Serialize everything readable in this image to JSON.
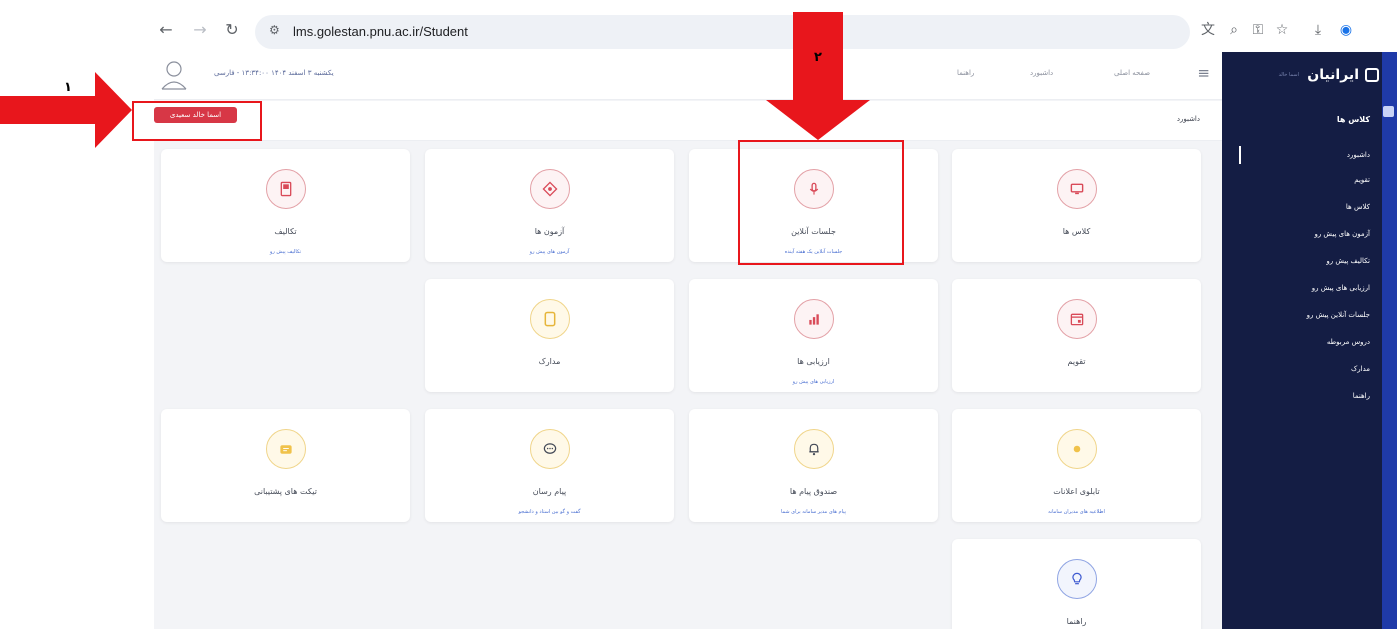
{
  "browser": {
    "url": "lms.golestan.pnu.ac.ir/Student",
    "back_icon": "arrow-left-icon",
    "forward_icon": "arrow-right-icon",
    "reload_icon": "reload-icon"
  },
  "header": {
    "date": "یکشنبه ۳ اسفند ۱۴۰۴ ۱۳:۳۴:۰۰ - فارسی",
    "links": [
      "صفحه اصلی",
      "داشبورد",
      "راهنما"
    ],
    "menu_icon": "hamburger-icon"
  },
  "breadcrumb": "داشبورد",
  "survey_button": "اسما خالد سعیدی",
  "sidebar": {
    "brand": "ایرانیان",
    "brand_sub": "اسما خالد",
    "heading": "کلاس ها",
    "items": [
      "داشبورد",
      "تقویم",
      "کلاس ها",
      "آزمون های پیش رو",
      "تکالیف پیش رو",
      "ارزیابی های پیش رو",
      "جلسات آنلاین پیش رو",
      "دروس مربوطه",
      "مدارک",
      "راهنما"
    ]
  },
  "cards": [
    {
      "title": "کلاس ها",
      "subtitle": "",
      "icon": "monitor-icon",
      "color": "red"
    },
    {
      "title": "جلسات آنلاین",
      "subtitle": "جلسات آنلاین یک هفته آینده",
      "icon": "microphone-icon",
      "color": "red"
    },
    {
      "title": "آزمون ها",
      "subtitle": "آزمون های پیش رو",
      "icon": "exam-icon",
      "color": "red"
    },
    {
      "title": "تکالیف",
      "subtitle": "تکالیف پیش رو",
      "icon": "assignment-icon",
      "color": "red"
    },
    {
      "title": "تقویم",
      "subtitle": "",
      "icon": "calendar-icon",
      "color": "red"
    },
    {
      "title": "ارزیابی ها",
      "subtitle": "ارزیابی های پیش رو",
      "icon": "chart-icon",
      "color": "red"
    },
    {
      "title": "مدارک",
      "subtitle": "",
      "icon": "document-icon",
      "color": "yellow"
    },
    {
      "title": "تابلوی اعلانات",
      "subtitle": "اطلاعیه های مدیران سامانه",
      "icon": "info-icon",
      "color": "yellow"
    },
    {
      "title": "صندوق پیام ها",
      "subtitle": "پیام های مدیر سامانه برای شما",
      "icon": "bell-icon",
      "color": "yellow"
    },
    {
      "title": "پیام رسان",
      "subtitle": "گفت و گو بین استاد و دانشجو",
      "icon": "chat-icon",
      "color": "yellow"
    },
    {
      "title": "تیکت های پشتیبانی",
      "subtitle": "",
      "icon": "ticket-icon",
      "color": "yellow"
    },
    {
      "title": "راهنما",
      "subtitle": "",
      "icon": "lightbulb-icon",
      "color": "blue"
    }
  ],
  "annotations": {
    "label_1": "۱",
    "label_2": "۲",
    "color": "#e8161c"
  }
}
